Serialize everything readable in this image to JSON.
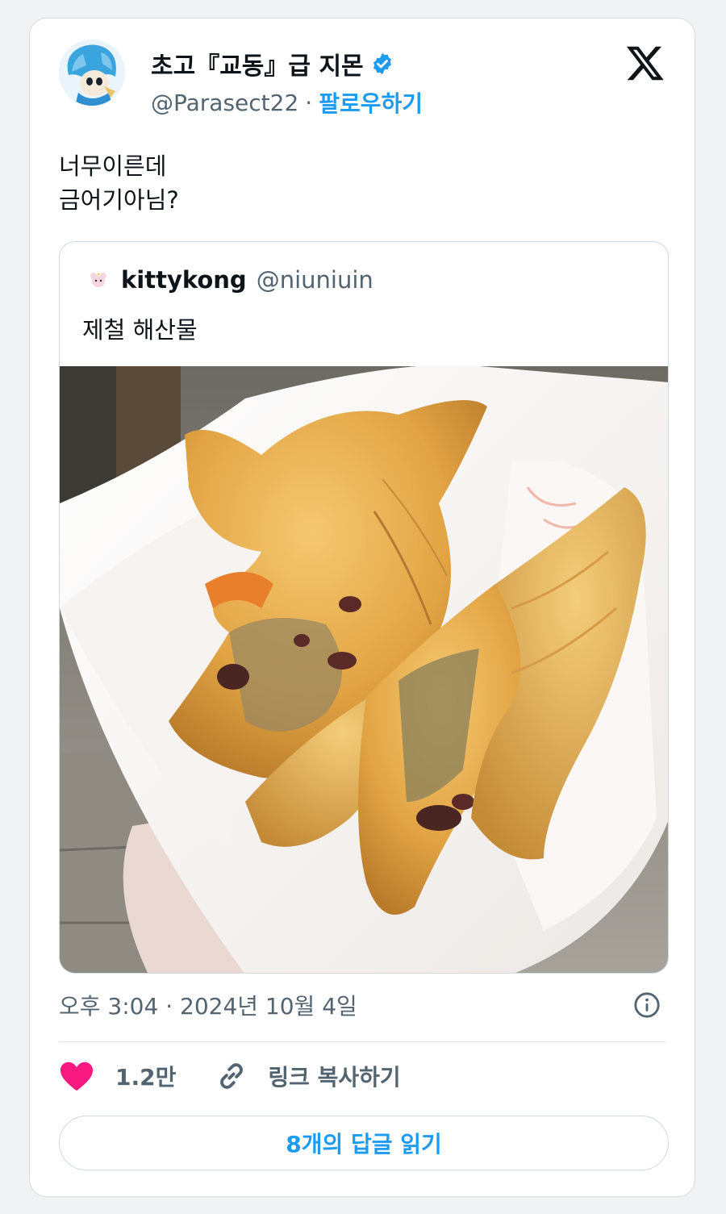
{
  "tweet": {
    "display_name": "초고『교동』급 지몬",
    "handle": "@Parasect22",
    "separator": "·",
    "follow_label": "팔로우하기",
    "text_lines": [
      "너무이른데",
      "금어기아님?"
    ],
    "timestamp": "오후 3:04 · 2024년 10월 4일",
    "like_count": "1.2만",
    "copy_link_label": "링크 복사하기",
    "replies_button_label": "8개의 답글 읽기"
  },
  "quote": {
    "display_name": "kittykong",
    "handle": "@niuniuin",
    "text": "제철 해산물"
  },
  "icons": {
    "verified": "verified-badge-icon",
    "brand": "x-logo-icon",
    "info": "info-icon",
    "like": "heart-icon",
    "copy": "link-icon"
  },
  "colors": {
    "accent": "#1d9bf0",
    "like": "#f91880",
    "text": "#0f1419",
    "muted": "#536471",
    "border": "#cfd9de"
  }
}
